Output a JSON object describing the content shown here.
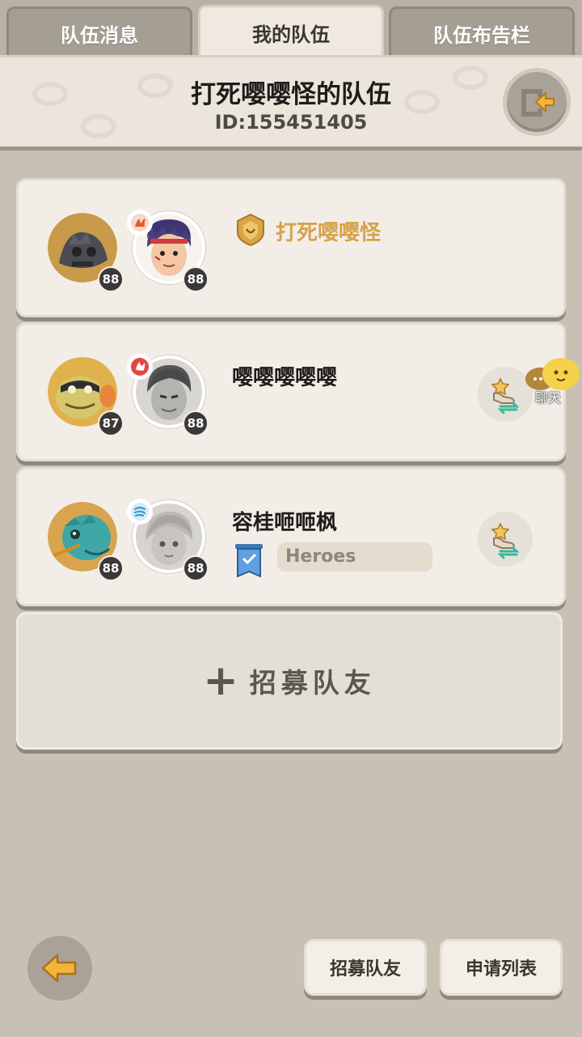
{
  "tabs": [
    {
      "label": "队伍消息",
      "active": false
    },
    {
      "label": "我的队伍",
      "active": true
    },
    {
      "label": "队伍布告栏",
      "active": false
    }
  ],
  "header": {
    "team_name": "打死嘤嘤怪的队伍",
    "team_id": "ID:155451405",
    "exit_icon": "exit-team-icon"
  },
  "members": [
    {
      "name": "打死嘤嘤怪",
      "is_leader": true,
      "pet_level": "88",
      "hero_level": "88",
      "element": "fire",
      "name_color": "#d6a24a"
    },
    {
      "name": "嘤嘤嘤嘤嘤",
      "is_leader": false,
      "pet_level": "87",
      "hero_level": "88",
      "element": "fire-red"
    },
    {
      "name": "容桂咂咂枫",
      "is_leader": false,
      "pet_level": "88",
      "hero_level": "88",
      "element": "wind",
      "guild": "Heroes"
    }
  ],
  "recruit_slot": {
    "plus": "+",
    "label": "招募队友"
  },
  "chat": {
    "label": "聊天"
  },
  "bottom": {
    "back_icon": "back-arrow-icon",
    "recruit_button": "招募队友",
    "apply_list_button": "申请列表"
  },
  "colors": {
    "background": "#c8c0b3",
    "card": "#f2eee7",
    "leader_gold": "#d6a24a",
    "accent_arrow": "#f2b53a"
  }
}
